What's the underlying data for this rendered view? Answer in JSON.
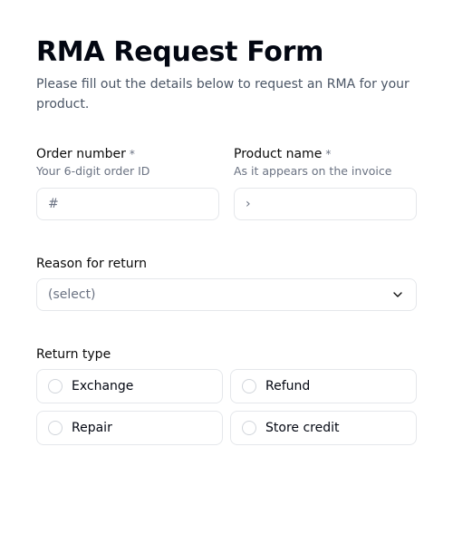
{
  "header": {
    "title": "RMA Request Form",
    "subtitle": "Please fill out the details below to request an RMA for your product."
  },
  "fields": {
    "order_number": {
      "label": "Order number",
      "required_marker": "*",
      "description": "Your 6-digit order ID",
      "placeholder": "#",
      "value": ""
    },
    "product_name": {
      "label": "Product name",
      "required_marker": "*",
      "description": "As it appears on the invoice",
      "placeholder": "›",
      "value": ""
    },
    "reason": {
      "label": "Reason for return",
      "placeholder": "(select)"
    },
    "return_type": {
      "label": "Return type",
      "options": [
        {
          "label": "Exchange"
        },
        {
          "label": "Refund"
        },
        {
          "label": "Repair"
        },
        {
          "label": "Store credit"
        }
      ]
    }
  }
}
